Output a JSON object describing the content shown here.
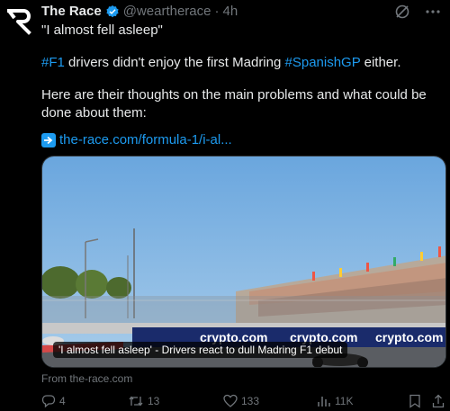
{
  "author": {
    "name": "The Race",
    "handle": "@weartherace",
    "separator": "·",
    "time": "4h"
  },
  "tweet": {
    "line1": "\"I almost fell asleep\"",
    "line2_hash1": "#F1",
    "line2_mid": " drivers didn't enjoy the first Madring ",
    "line2_hash2": "#SpanishGP",
    "line2_end": " either.",
    "line3": "Here are their thoughts on the main problems and what could be done about them:",
    "link": "the-race.com/formula-1/i-al..."
  },
  "card": {
    "caption": "'I almost fell asleep' - Drivers react to dull Madring F1 debut",
    "banner_text": "crypto.com",
    "source": "From the-race.com"
  },
  "actions": {
    "replies": "4",
    "reposts": "13",
    "likes": "133",
    "views": "11K"
  },
  "colors": {
    "link": "#1d9bf0",
    "muted": "#71767b",
    "banner": "#1a2b6b"
  },
  "icons": [
    "the-race-logo-icon",
    "verified-badge-icon",
    "grok-icon",
    "more-icon",
    "link-arrow-emoji-icon",
    "reply-icon",
    "repost-icon",
    "like-icon",
    "views-icon",
    "bookmark-icon"
  ]
}
